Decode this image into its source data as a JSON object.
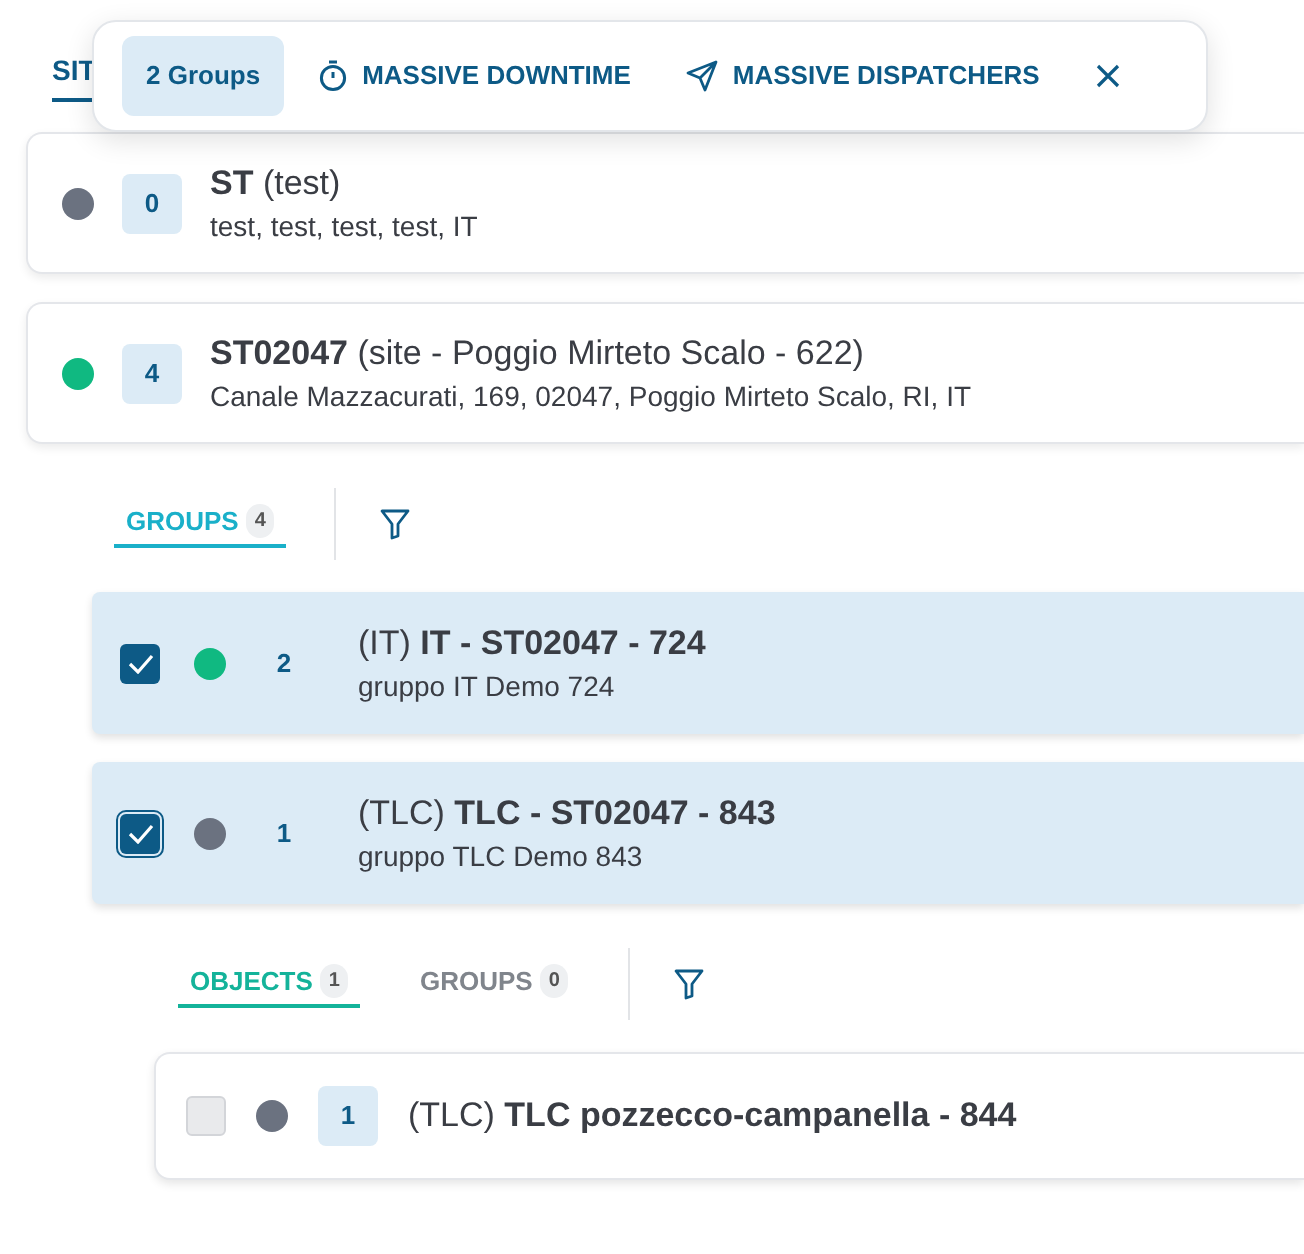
{
  "toolbar": {
    "selection": "2 Groups",
    "actions": [
      {
        "label": "MASSIVE DOWNTIME",
        "kind": "timer"
      },
      {
        "label": "MASSIVE DISPATCHERS",
        "kind": "send"
      }
    ]
  },
  "sites_tab": {
    "label": "SIT",
    "selected": true
  },
  "sites": [
    {
      "name": "ST",
      "detail": "(test)",
      "address": "test, test, test, test, IT",
      "count": "0",
      "color": "#6b7280"
    },
    {
      "name": "ST02047",
      "detail": "(site - Poggio Mirteto Scalo - 622)",
      "address": "Canale Mazzacurati, 169, 02047, Poggio Mirteto Scalo, RI, IT",
      "count": "4",
      "color": "#10b981"
    }
  ],
  "group_tabs": [
    {
      "label": "GROUPS",
      "count": "4",
      "selected": true
    }
  ],
  "groups": [
    {
      "checked": true,
      "focused": false,
      "color": "#10b981",
      "count": "2",
      "prefix": "(IT)",
      "name": "IT - ST02047 - 724",
      "description": "gruppo IT Demo 724"
    },
    {
      "checked": true,
      "focused": true,
      "color": "#6b7280",
      "count": "1",
      "prefix": "(TLC)",
      "name": "TLC - ST02047 - 843",
      "description": "gruppo TLC Demo 843"
    }
  ],
  "object_tabs": [
    {
      "label": "OBJECTS",
      "count": "1",
      "selected": true
    },
    {
      "label": "GROUPS",
      "count": "0",
      "selected": false
    }
  ],
  "objects": [
    {
      "checked": false,
      "color": "#6b7280",
      "count": "1",
      "prefix": "(TLC)",
      "name": "TLC pozzecco-campanella - 844"
    }
  ]
}
